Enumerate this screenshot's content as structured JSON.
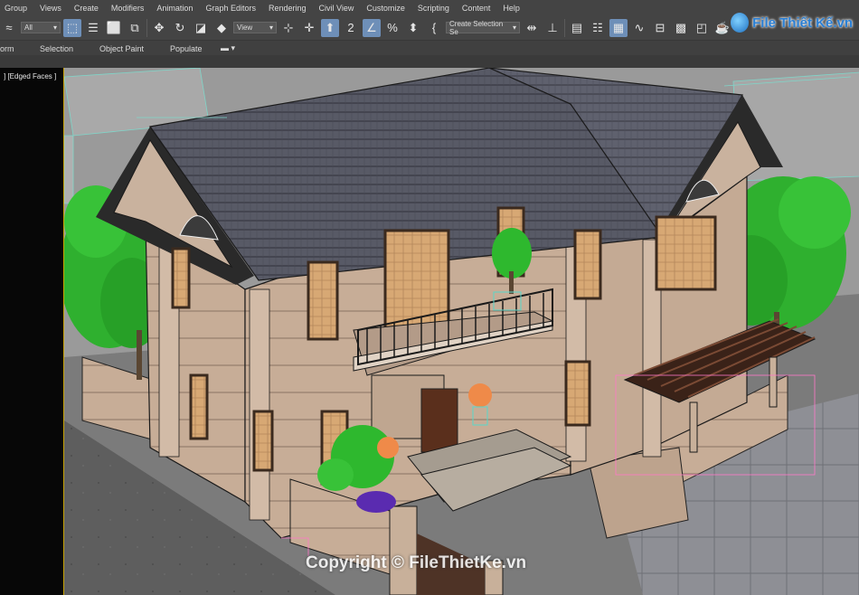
{
  "menu": [
    "Group",
    "Views",
    "Create",
    "Modifiers",
    "Animation",
    "Graph Editors",
    "Rendering",
    "Civil View",
    "Customize",
    "Scripting",
    "Content",
    "Help"
  ],
  "toolbar": {
    "filter_value": "All",
    "view_value": "View",
    "snap_value": "2",
    "selection_set_value": "Create Selection Se"
  },
  "ribbon": {
    "tabs": [
      "orm",
      "Selection",
      "Object Paint",
      "Populate"
    ]
  },
  "viewport": {
    "label": "] [Edged Faces ]"
  },
  "logo": {
    "text": "File Thiết Kế.vn"
  },
  "watermark": {
    "text": "Copyright © FileThietKe.vn"
  }
}
